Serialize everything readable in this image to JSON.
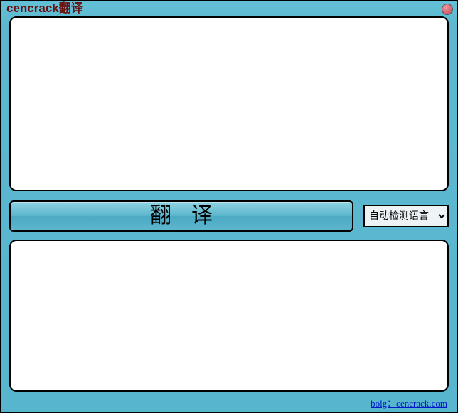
{
  "window": {
    "title": "cencrack翻译"
  },
  "input": {
    "value": "",
    "placeholder": ""
  },
  "output": {
    "value": "",
    "placeholder": ""
  },
  "actions": {
    "translate_label": "翻译"
  },
  "language": {
    "selected": "自动检测语言",
    "options": [
      "自动检测语言"
    ]
  },
  "footer": {
    "link_text": "bolg：cencrack.com"
  }
}
